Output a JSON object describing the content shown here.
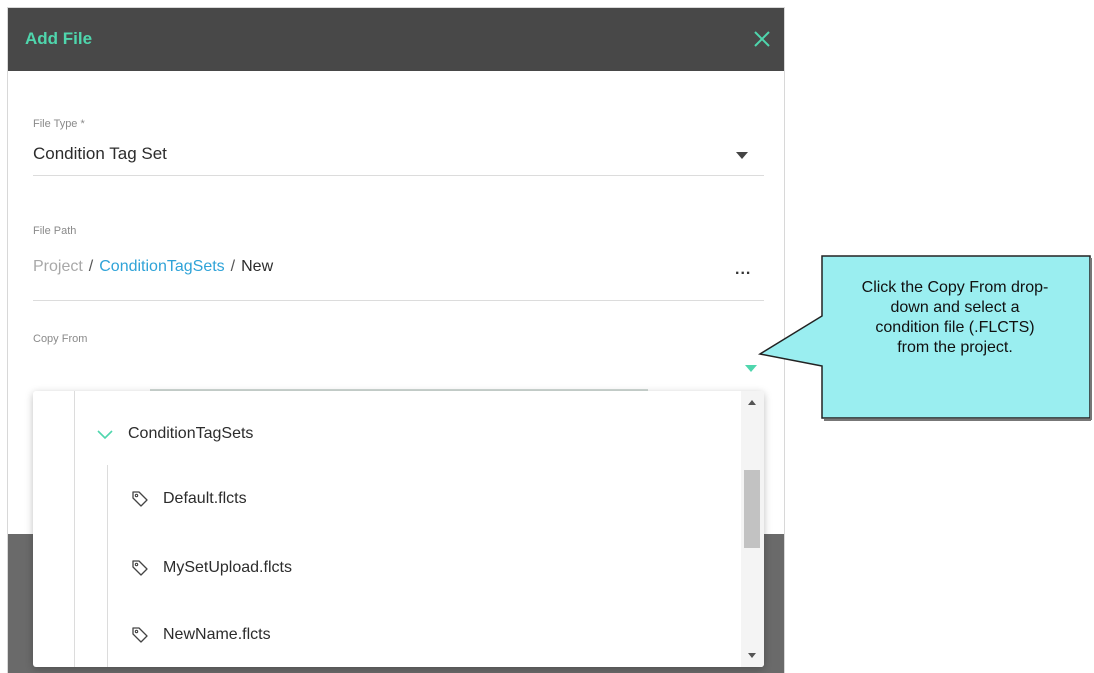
{
  "dialog": {
    "title": "Add File",
    "file_type": {
      "label": "File Type *",
      "value": "Condition Tag Set"
    },
    "file_path": {
      "label": "File Path",
      "root": "Project",
      "separator": "/",
      "folder": "ConditionTagSets",
      "name": "New",
      "more": "..."
    },
    "copy_from": {
      "label": "Copy From",
      "value": ""
    }
  },
  "dropdown": {
    "folder": "ConditionTagSets",
    "items": [
      {
        "label": "Default.flcts",
        "icon": "tag-icon"
      },
      {
        "label": "MySetUpload.flcts",
        "icon": "tag-icon"
      },
      {
        "label": "NewName.flcts",
        "icon": "tag-icon"
      }
    ]
  },
  "callout": {
    "lines": [
      "Click the Copy From drop-",
      "down and select a",
      "condition file (.FLCTS)",
      "from the project."
    ]
  },
  "colors": {
    "header_bg": "#484848",
    "accent": "#4fd6ad",
    "link": "#2fa3d8",
    "callout_fill": "#9aeef0"
  }
}
